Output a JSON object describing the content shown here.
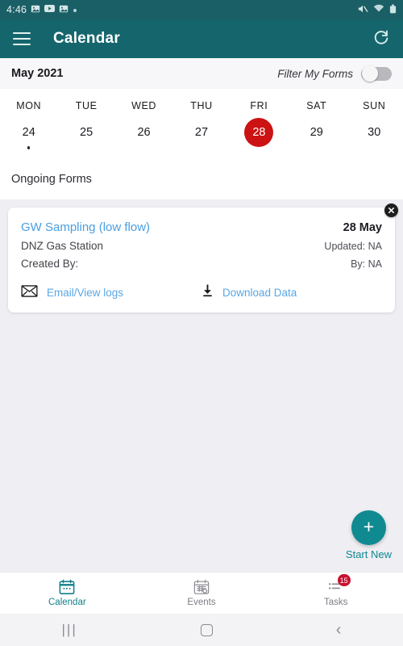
{
  "status_bar": {
    "time": "4:46",
    "left_icons": [
      "photo-icon",
      "youtube-icon",
      "gallery-icon",
      "dot-icon"
    ],
    "right_icons": [
      "mute-icon",
      "wifi-icon",
      "battery-icon"
    ]
  },
  "app_bar": {
    "menu_icon": "hamburger-menu-icon",
    "title": "Calendar",
    "refresh_icon": "refresh-icon"
  },
  "calendar": {
    "month_label": "May 2021",
    "filter_label": "Filter My Forms",
    "filter_enabled": false,
    "day_names": [
      "MON",
      "TUE",
      "WED",
      "THU",
      "FRI",
      "SAT",
      "SUN"
    ],
    "dates": [
      {
        "num": "24",
        "selected": false,
        "has_event": true
      },
      {
        "num": "25",
        "selected": false,
        "has_event": false
      },
      {
        "num": "26",
        "selected": false,
        "has_event": false
      },
      {
        "num": "27",
        "selected": false,
        "has_event": false
      },
      {
        "num": "28",
        "selected": true,
        "has_event": false
      },
      {
        "num": "29",
        "selected": false,
        "has_event": false
      },
      {
        "num": "30",
        "selected": false,
        "has_event": false
      }
    ],
    "selected_color": "#cc1212"
  },
  "section": {
    "title": "Ongoing Forms"
  },
  "form_card": {
    "close_icon": "close-icon",
    "title": "GW Sampling (low flow)",
    "date": "28 May",
    "site": "DNZ Gas Station",
    "updated": "Updated: NA",
    "created_by": "Created By:",
    "by": "By: NA",
    "actions": [
      {
        "icon": "envelope-icon",
        "label": "Email/View logs"
      },
      {
        "icon": "download-icon",
        "label": "Download Data"
      }
    ],
    "link_color": "#5aa7e4"
  },
  "fab": {
    "icon": "plus-icon",
    "label": "Start New",
    "color": "#0f8a90"
  },
  "bottom_nav": {
    "items": [
      {
        "icon": "calendar-icon",
        "label": "Calendar",
        "active": true,
        "badge": null
      },
      {
        "icon": "events-calendar-icon",
        "label": "Events",
        "active": false,
        "badge": null
      },
      {
        "icon": "tasks-list-icon",
        "label": "Tasks",
        "active": false,
        "badge": "15"
      }
    ],
    "active_color": "#11808a",
    "badge_color": "#c8102e"
  },
  "system_nav": {
    "recent_icon": "recent-apps-icon",
    "home_icon": "home-icon",
    "back_icon": "back-icon"
  }
}
